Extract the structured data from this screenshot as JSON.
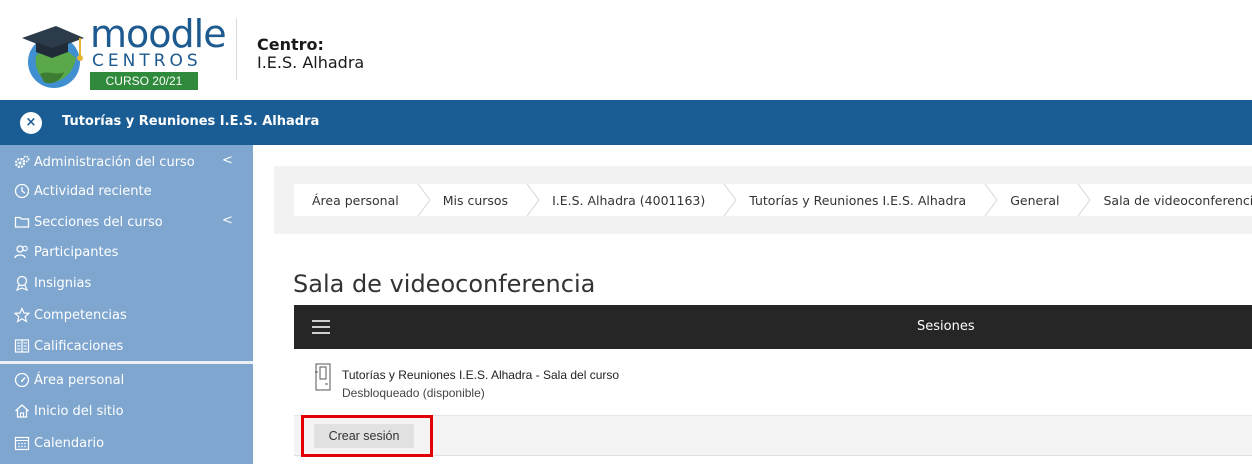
{
  "header": {
    "logo_text": "moodle",
    "logo_sub": "CENTROS",
    "logo_badge": "CURSO 20/21",
    "centro_label": "Centro:",
    "centro_name": "I.E.S. Alhadra"
  },
  "navbar": {
    "close_label": "×",
    "title": "Tutorías y Reuniones I.E.S. Alhadra"
  },
  "sidebar": {
    "items": [
      {
        "label": "Administración del curso",
        "icon": "gears-icon"
      },
      {
        "label": "Actividad reciente",
        "icon": "clock-icon"
      },
      {
        "label": "Secciones del curso",
        "icon": "folder-icon"
      },
      {
        "label": "Participantes",
        "icon": "users-icon"
      },
      {
        "label": "Insignias",
        "icon": "badge-icon"
      },
      {
        "label": "Competencias",
        "icon": "star-icon"
      },
      {
        "label": "Calificaciones",
        "icon": "grades-icon"
      },
      {
        "label": "Área personal",
        "icon": "dashboard-icon"
      },
      {
        "label": "Inicio del sitio",
        "icon": "home-icon"
      },
      {
        "label": "Calendario",
        "icon": "calendar-icon"
      }
    ],
    "chevron": "<"
  },
  "breadcrumb": [
    "Área personal",
    "Mis cursos",
    "I.E.S. Alhadra (4001163)",
    "Tutorías y Reuniones I.E.S. Alhadra",
    "General",
    "Sala de videoconferencia"
  ],
  "main": {
    "page_title": "Sala de videoconferencia",
    "sessions_title": "Sesiones",
    "room_name": "Tutorías y Reuniones I.E.S. Alhadra - Sala del curso",
    "room_status": "Desbloqueado (disponible)",
    "create_button": "Crear sesión"
  },
  "colors": {
    "navbar": "#1a5c94",
    "sidebar": "#7ea6cf",
    "highlight": "#e30000"
  }
}
